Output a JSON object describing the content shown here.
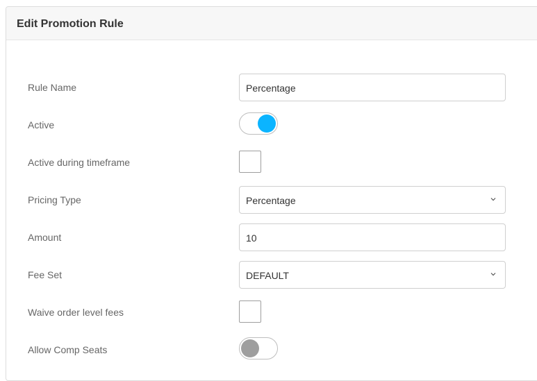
{
  "panel": {
    "title": "Edit Promotion Rule"
  },
  "form": {
    "rule_name": {
      "label": "Rule Name",
      "value": "Percentage"
    },
    "active": {
      "label": "Active",
      "on": true,
      "color": "#0bb4ff"
    },
    "active_timeframe": {
      "label": "Active during timeframe",
      "checked": false
    },
    "pricing_type": {
      "label": "Pricing Type",
      "value": "Percentage"
    },
    "amount": {
      "label": "Amount",
      "value": "10"
    },
    "fee_set": {
      "label": "Fee Set",
      "value": "DEFAULT"
    },
    "waive_fees": {
      "label": "Waive order level fees",
      "checked": false
    },
    "allow_comp_seats": {
      "label": "Allow Comp Seats",
      "on": false,
      "color": "#9e9e9e"
    }
  },
  "icons": {
    "select_chevron": "chevron-down-icon"
  }
}
